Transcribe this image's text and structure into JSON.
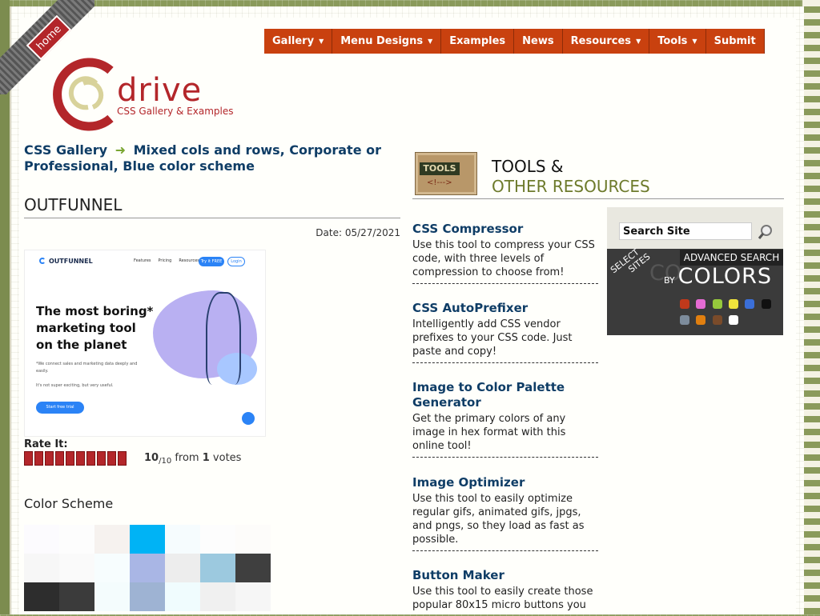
{
  "home_label": "home",
  "nav": [
    {
      "label": "Gallery",
      "caret": true
    },
    {
      "label": "Menu Designs",
      "caret": true
    },
    {
      "label": "Examples",
      "caret": false
    },
    {
      "label": "News",
      "caret": false
    },
    {
      "label": "Resources",
      "caret": true
    },
    {
      "label": "Tools",
      "caret": true
    },
    {
      "label": "Submit",
      "caret": false
    }
  ],
  "logo": {
    "word": "drive",
    "tagline": "CSS Gallery & Examples"
  },
  "breadcrumb": {
    "root": "CSS Gallery",
    "arrow": "➜",
    "trail": "Mixed cols and rows, Corporate or Professional, Blue color scheme"
  },
  "site": {
    "title": "OUTFUNNEL",
    "date": "Date: 05/27/2021"
  },
  "preview": {
    "logo": "OUTFUNNEL",
    "links": [
      "Features",
      "Pricing",
      "Resources"
    ],
    "btn_primary": "Try it FREE",
    "btn_secondary": "Login",
    "headline": "The most boring* marketing tool on the planet",
    "body": "*We connect sales and marketing data deeply and easily.",
    "body2": "It's not super exciting, but very useful.",
    "cta": "Start free trial"
  },
  "rating": {
    "label": "Rate It:",
    "score": "10",
    "of": "/10",
    "from": "from",
    "votes": "1",
    "votes_word": "votes",
    "stars": 10
  },
  "color_scheme": {
    "title": "Color Scheme",
    "swatches": [
      "#fcfbfe",
      "#fdfdfd",
      "#f6f2ef",
      "#00b3f5",
      "#f6fcfe",
      "#fdfdfd",
      "#fdfcfa",
      "#f7f7f7",
      "#fafafa",
      "#f7fdfe",
      "#a9b6e5",
      "#ededed",
      "#9cc9df",
      "#3f3f3f",
      "#2d2d2d",
      "#3b3b3b",
      "#f4fcfd",
      "#9eb3d3",
      "#f0fcfe",
      "#f0f0f0",
      "#f6f6f6"
    ]
  },
  "tools_section": {
    "badge_top": "TOOLS",
    "badge_bottom": "<!--->",
    "head_line1": "TOOLS &",
    "head_line2": "OTHER RESOURCES",
    "items": [
      {
        "name": "CSS Compressor",
        "desc": "Use this tool to compress your CSS code, with three levels of compression to choose from!"
      },
      {
        "name": "CSS AutoPrefixer",
        "desc": "Intelligently add CSS vendor prefixes to your CSS code. Just paste and copy!"
      },
      {
        "name": "Image to Color Palette Generator",
        "desc": "Get the primary colors of any image in hex format with this online tool!"
      },
      {
        "name": "Image Optimizer",
        "desc": "Use this tool to easily optimize regular gifs, animated gifs, jpgs, and pngs, so they load as fast as possible."
      },
      {
        "name": "Button Maker",
        "desc": "Use this tool to easily create those popular 80x15 micro buttons you"
      }
    ]
  },
  "search": {
    "placeholder": "Search Site",
    "advanced": "ADVANCED SEARCH",
    "select_line1": "SELECT",
    "select_line2": "SITES",
    "by": "BY",
    "colors": "COLORS",
    "ghost": "CO",
    "chips": [
      "#c0391b",
      "#e56bd3",
      "#96c93c",
      "#f0e43c",
      "#3b6fd8",
      "#111111",
      "#7d8c9c",
      "#e17f0f",
      "#7a4b2a",
      "#ffffff"
    ]
  }
}
